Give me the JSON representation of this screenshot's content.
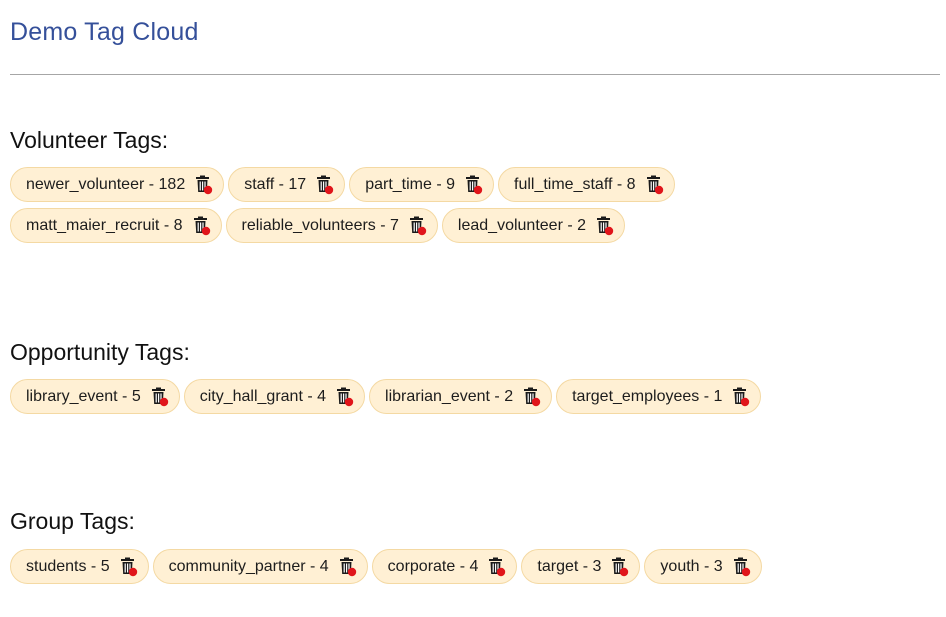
{
  "page": {
    "title": "Demo Tag Cloud"
  },
  "colors": {
    "title": "#35509a",
    "tag_bg": "#fff0d4",
    "tag_border": "#f4d9a3",
    "delete_dot": "#e0151b"
  },
  "sections": [
    {
      "heading": "Volunteer Tags:",
      "tags": [
        {
          "label": "newer_volunteer - 182"
        },
        {
          "label": "staff - 17"
        },
        {
          "label": "part_time - 9"
        },
        {
          "label": "full_time_staff - 8"
        },
        {
          "label": "matt_maier_recruit - 8"
        },
        {
          "label": "reliable_volunteers - 7"
        },
        {
          "label": "lead_volunteer - 2"
        }
      ]
    },
    {
      "heading": "Opportunity Tags:",
      "tags": [
        {
          "label": "library_event - 5"
        },
        {
          "label": "city_hall_grant - 4"
        },
        {
          "label": "librarian_event - 2"
        },
        {
          "label": "target_employees - 1"
        }
      ]
    },
    {
      "heading": "Group Tags:",
      "tags": [
        {
          "label": "students - 5"
        },
        {
          "label": "community_partner - 4"
        },
        {
          "label": "corporate - 4"
        },
        {
          "label": "target - 3"
        },
        {
          "label": "youth - 3"
        }
      ]
    }
  ],
  "icons": {
    "delete": "trash-delete-icon"
  }
}
